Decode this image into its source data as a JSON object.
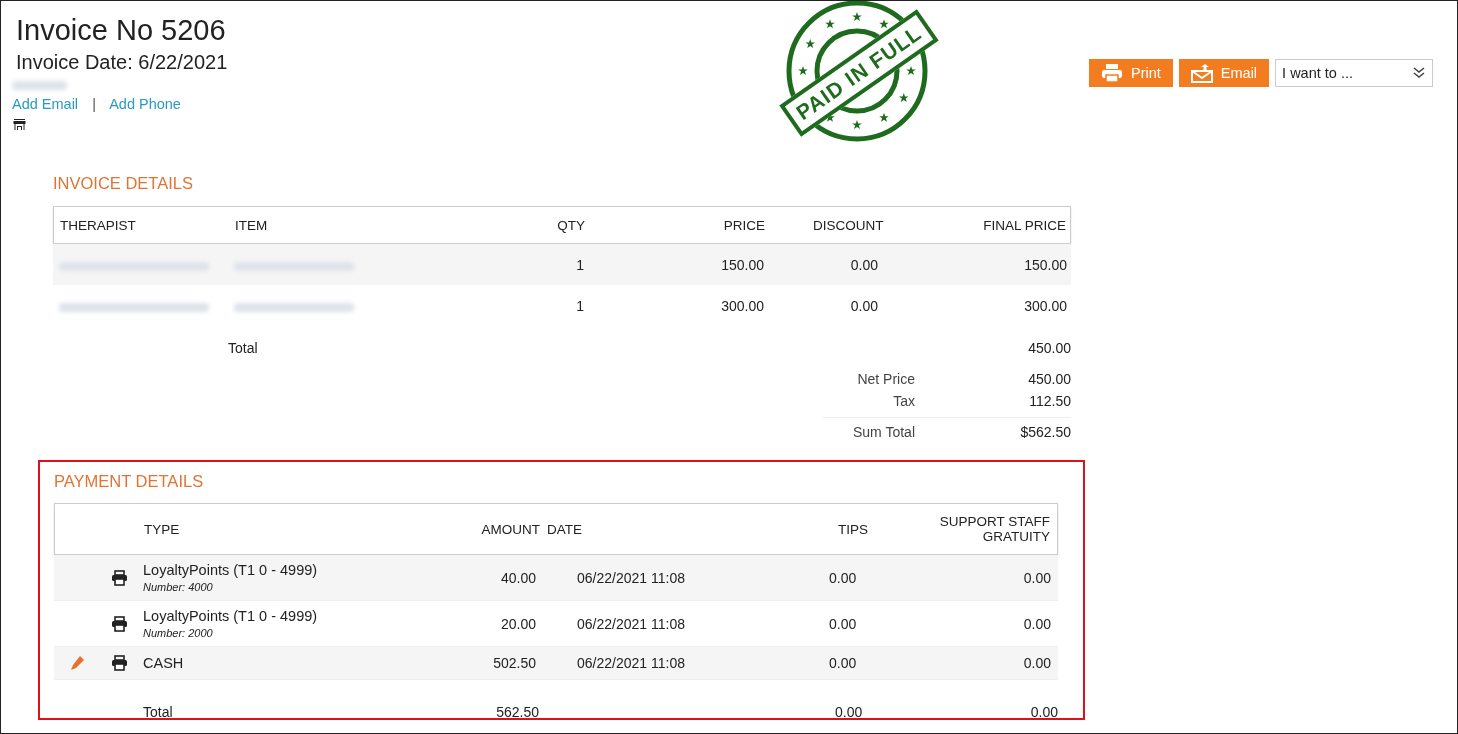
{
  "header": {
    "title": "Invoice No 5206",
    "date": "Invoice Date: 6/22/2021",
    "links": [
      "Add Email",
      "Add Phone"
    ],
    "separator": "|"
  },
  "stamp": {
    "text": "PAID IN FULL"
  },
  "actions": {
    "buttons": [
      {
        "label": "Print",
        "kind": "print"
      },
      {
        "label": "Email",
        "kind": "email"
      }
    ],
    "menu": {
      "placeholder": "I want to ..."
    }
  },
  "invoice_details": {
    "title": "INVOICE DETAILS",
    "columns": [
      "THERAPIST",
      "ITEM",
      "QTY",
      "PRICE",
      "DISCOUNT",
      "FINAL PRICE"
    ],
    "rows": [
      {
        "qty": "1",
        "price": "150.00",
        "discount": "0.00",
        "final_price": "150.00"
      },
      {
        "qty": "1",
        "price": "300.00",
        "discount": "0.00",
        "final_price": "300.00"
      }
    ],
    "total": {
      "label": "Total",
      "value": "450.00"
    },
    "summary": [
      {
        "label": "Net Price",
        "value": "450.00"
      },
      {
        "label": "Tax",
        "value": "112.50"
      },
      {
        "label": "Sum Total",
        "value": "$562.50"
      }
    ]
  },
  "payment_details": {
    "title": "PAYMENT DETAILS",
    "highlighted": true,
    "columns": [
      "TYPE",
      "AMOUNT",
      "DATE",
      "TIPS",
      "SUPPORT STAFF GRATUITY"
    ],
    "rows": [
      {
        "type": "LoyaltyPoints (T1 0 - 4999)",
        "note": "Number: 4000",
        "amount": "40.00",
        "date": "06/22/2021 11:08",
        "tips": "0.00",
        "gratuity": "0.00",
        "editable": false
      },
      {
        "type": "LoyaltyPoints (T1 0 - 4999)",
        "note": "Number: 2000",
        "amount": "20.00",
        "date": "06/22/2021 11:08",
        "tips": "0.00",
        "gratuity": "0.00",
        "editable": false
      },
      {
        "type": "CASH",
        "amount": "502.50",
        "date": "06/22/2021 11:08",
        "tips": "0.00",
        "gratuity": "0.00",
        "editable": true
      }
    ],
    "total": {
      "label": "Total",
      "amount": "562.50",
      "tips": "0.00",
      "gratuity": "0.00"
    }
  }
}
